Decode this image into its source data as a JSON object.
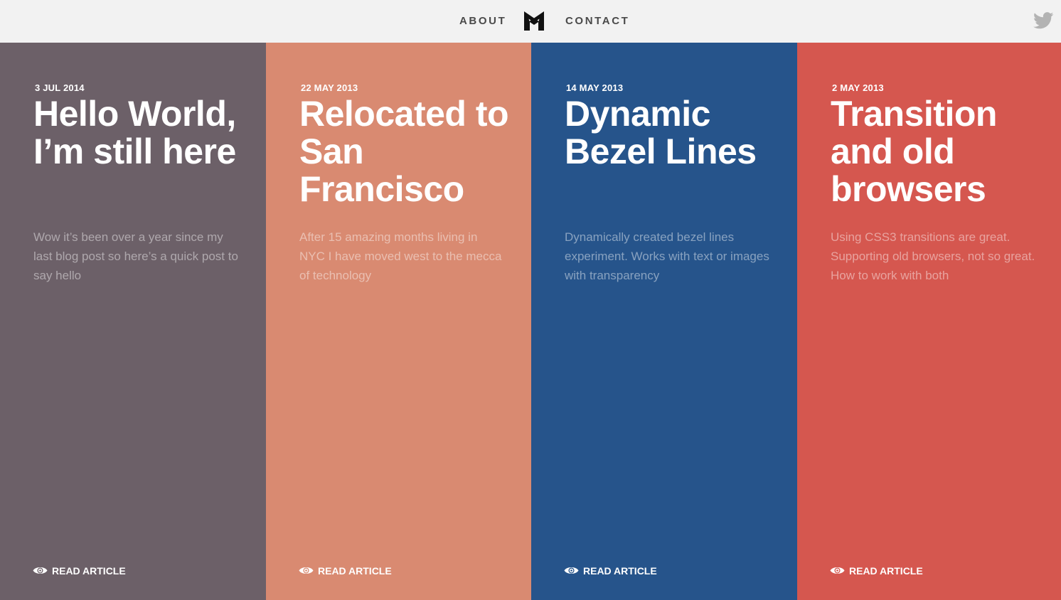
{
  "nav": {
    "about_label": "ABOUT",
    "contact_label": "CONTACT",
    "logo_icon": "m-logo-icon",
    "twitter_icon": "twitter-bird-icon"
  },
  "colors": {
    "topbar": "#f2f2f2",
    "nav_text": "#4a4a4a",
    "twitter": "#b3b3b3"
  },
  "articles": [
    {
      "date": "3 JUL 2014",
      "title": "Hello World, I’m still here",
      "excerpt": "Wow it’s been over a year since my last blog post so here’s a quick post to say hello",
      "read_label": "READ ARTICLE",
      "color": "#6c6068"
    },
    {
      "date": "22 MAY 2013",
      "title": "Relocated to San Francisco",
      "excerpt": "After 15 amazing months living in NYC I have moved west to the mecca of technology",
      "read_label": "READ ARTICLE",
      "color": "#d98a71"
    },
    {
      "date": "14 MAY 2013",
      "title": "Dynamic Bezel Lines",
      "excerpt": "Dynamically created bezel lines experiment. Works with text or images with transparency",
      "read_label": "READ ARTICLE",
      "color": "#26548b"
    },
    {
      "date": "2 MAY 2013",
      "title": "Transition and old browsers",
      "excerpt": "Using CSS3 transitions are great. Supporting old browsers, not so great. How to work with both",
      "read_label": "READ ARTICLE",
      "color": "#d5574f"
    }
  ]
}
